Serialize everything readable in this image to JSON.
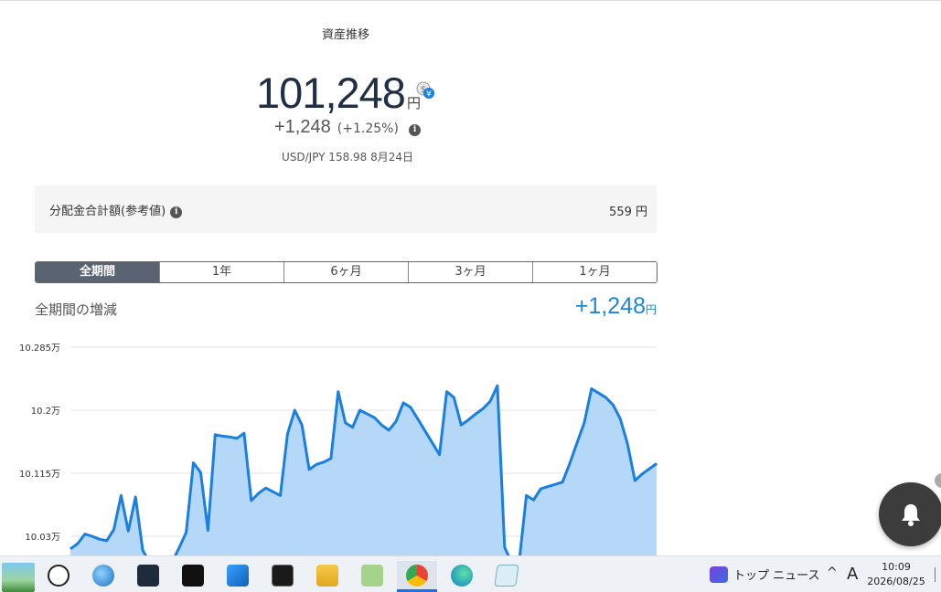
{
  "page_title": "資産推移",
  "balance": {
    "amount": "101,248",
    "unit": "円"
  },
  "change": {
    "amount": "+1,248",
    "percent": "(+1.25%)"
  },
  "fx_rate": "USD/JPY 158.98 8月24日",
  "distribution": {
    "label": "分配金合計額(参考値)",
    "value": "559 円"
  },
  "tabs": [
    {
      "label": "全期間",
      "active": true
    },
    {
      "label": "1年",
      "active": false
    },
    {
      "label": "6ヶ月",
      "active": false
    },
    {
      "label": "3ヶ月",
      "active": false
    },
    {
      "label": "1ヶ月",
      "active": false
    }
  ],
  "period": {
    "label": "全期間の増減",
    "value": "+1,248",
    "unit": "円"
  },
  "chart_data": {
    "type": "area",
    "y_tick_labels": [
      "10.285万",
      "10.2万",
      "10.115万",
      "10.03万"
    ],
    "y_ticks": [
      102850,
      102000,
      101150,
      100300
    ],
    "ylim": [
      99940,
      102850
    ],
    "grid": true,
    "line_color": "#1a7fe0",
    "fill_color": "#b6d8f8",
    "values": [
      100130,
      100200,
      100330,
      100300,
      100260,
      100240,
      100390,
      100850,
      100370,
      100830,
      100110,
      99940,
      99940,
      99940,
      99940,
      100140,
      100350,
      101290,
      101160,
      100380,
      101670,
      101650,
      101640,
      101620,
      101690,
      100780,
      100880,
      100950,
      100900,
      100850,
      101680,
      102000,
      101800,
      101200,
      101270,
      101300,
      101350,
      102250,
      101830,
      101770,
      102000,
      101950,
      101900,
      101800,
      101730,
      101850,
      102100,
      102040,
      101880,
      101720,
      101560,
      101400,
      102250,
      102170,
      101800,
      101870,
      101950,
      102020,
      102120,
      102330,
      100150,
      99940,
      99940,
      100850,
      100790,
      100940,
      100970,
      101000,
      101030,
      101280,
      101560,
      101830,
      102290,
      102230,
      102170,
      102070,
      101880,
      101540,
      101050,
      101140,
      101210,
      101280
    ]
  },
  "notification": {
    "icon": "bell-icon"
  },
  "taskbar": {
    "apps": [
      "landscape-icon",
      "speech-app-icon",
      "browser-swirl-icon",
      "video-editor-icon",
      "d-app-icon",
      "outlook-icon",
      "terminal-icon",
      "file-explorer-icon",
      "v-app-icon",
      "chrome-icon",
      "edge-icon",
      "notepad-icon"
    ],
    "active_app": "chrome-icon",
    "news_label": "トップ ニュース",
    "tray_chevron": "^",
    "ime": "A",
    "time": "10:09",
    "date": "2026/08/25"
  }
}
